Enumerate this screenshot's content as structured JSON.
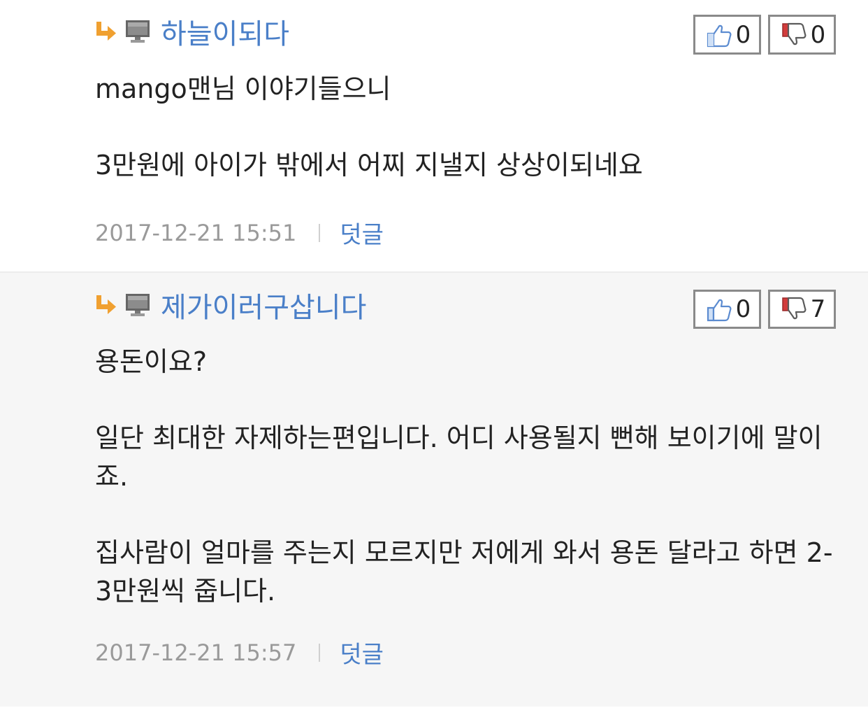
{
  "comments": [
    {
      "author": "하늘이되다",
      "likes": "0",
      "dislikes": "0",
      "paragraphs": [
        "mango맨님 이야기들으니",
        "3만원에 아이가 밖에서 어찌 지낼지 상상이되네요"
      ],
      "timestamp": "2017-12-21 15:51",
      "reply_label": "덧글"
    },
    {
      "author": "제가이러구삽니다",
      "likes": "0",
      "dislikes": "7",
      "paragraphs": [
        "용돈이요?",
        "일단 최대한 자제하는편입니다. 어디 사용될지 뻔해 보이기에 말이죠.",
        "집사람이 얼마를 주는지 모르지만 저에게 와서 용돈 달라고 하면 2-3만원씩 줍니다."
      ],
      "timestamp": "2017-12-21 15:57",
      "reply_label": "덧글"
    }
  ],
  "icons": {
    "reply": "reply-arrow-icon",
    "device": "pc-monitor-icon",
    "like": "thumbs-up-icon",
    "dislike": "thumbs-down-icon"
  },
  "colors": {
    "author": "#4a7fc8",
    "reply_arrow": "#f0a030",
    "text": "#222222",
    "meta": "#9a9a9a",
    "alt_background": "#f6f6f6"
  }
}
